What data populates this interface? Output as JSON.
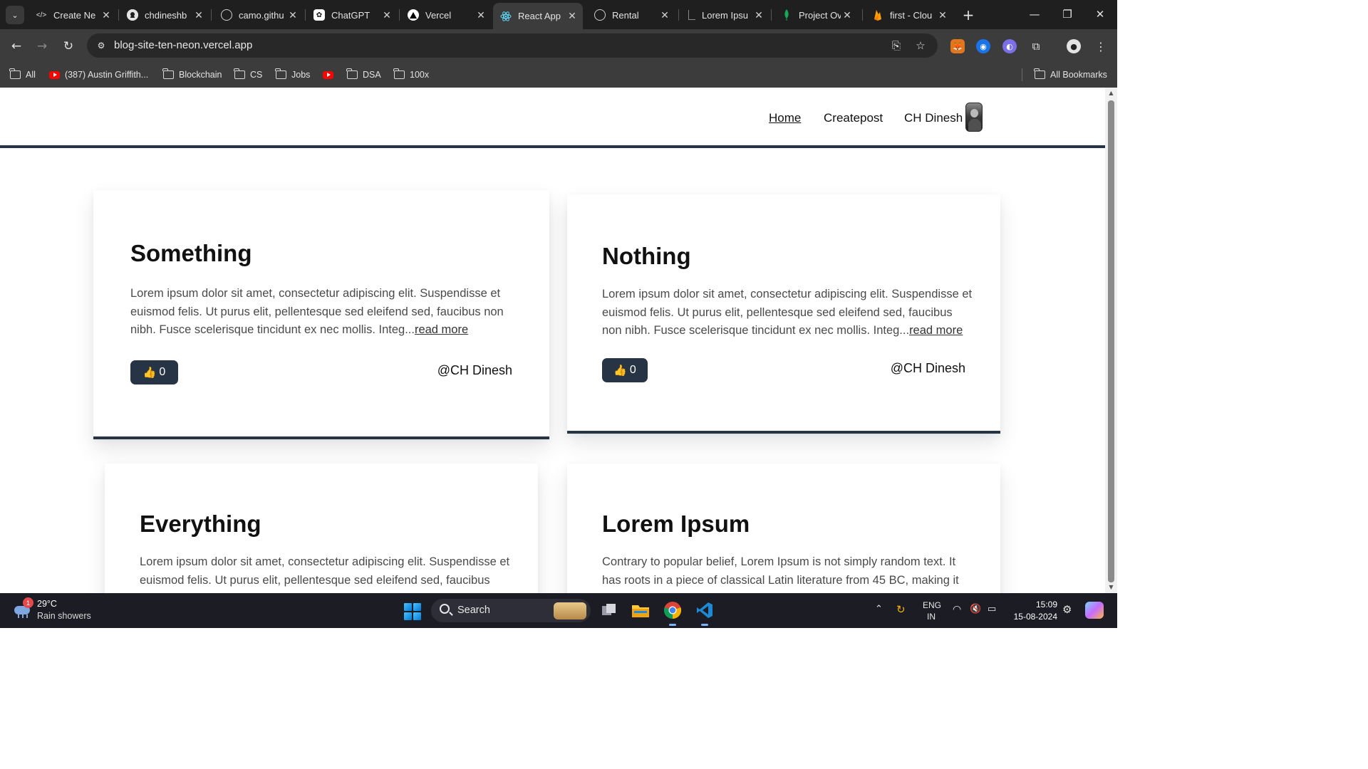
{
  "browser": {
    "tabs": [
      {
        "title": "Create Ne",
        "icon": "code-icon"
      },
      {
        "title": "chdineshb",
        "icon": "github-icon"
      },
      {
        "title": "camo.githu",
        "icon": "globe-icon"
      },
      {
        "title": "ChatGPT",
        "icon": "chatgpt-icon"
      },
      {
        "title": "Vercel",
        "icon": "vercel-icon"
      },
      {
        "title": "React App",
        "icon": "react-icon",
        "active": true
      },
      {
        "title": "Rental",
        "icon": "globe-icon"
      },
      {
        "title": "Lorem Ipsu",
        "icon": "document-icon"
      },
      {
        "title": "Project Ov",
        "icon": "mongodb-icon"
      },
      {
        "title": "first - Clou",
        "icon": "firebase-icon"
      }
    ],
    "url": "blog-site-ten-neon.vercel.app",
    "bookmarks": [
      {
        "label": "All",
        "icon": "folder-icon"
      },
      {
        "label": "(387) Austin Griffith...",
        "icon": "youtube-icon"
      },
      {
        "label": "Blockchain",
        "icon": "folder-icon"
      },
      {
        "label": "CS",
        "icon": "folder-icon"
      },
      {
        "label": "Jobs",
        "icon": "folder-icon"
      },
      {
        "label": "",
        "icon": "youtube-icon"
      },
      {
        "label": "DSA",
        "icon": "folder-icon"
      },
      {
        "label": "100x",
        "icon": "folder-icon"
      }
    ],
    "all_bookmarks": "All Bookmarks"
  },
  "site": {
    "nav": {
      "home": "Home",
      "createpost": "Createpost",
      "user": "CH Dinesh"
    },
    "posts": [
      {
        "title": "Something",
        "body": "Lorem ipsum dolor sit amet, consectetur adipiscing elit. Suspendisse et euismod felis. Ut purus elit, pellentesque sed eleifend sed, faucibus non nibh. Fusce scelerisque tincidunt ex nec mollis. Integ...",
        "read_more": "read more",
        "likes": "0",
        "author": "@CH Dinesh"
      },
      {
        "title": "Nothing",
        "body": "Lorem ipsum dolor sit amet, consectetur adipiscing elit. Suspendisse et euismod felis. Ut purus elit, pellentesque sed eleifend sed, faucibus non nibh. Fusce scelerisque tincidunt ex nec mollis. Integ...",
        "read_more": "read more",
        "likes": "0",
        "author": "@CH Dinesh"
      },
      {
        "title": "Everything",
        "body": "Lorem ipsum dolor sit amet, consectetur adipiscing elit. Suspendisse et euismod felis. Ut purus elit, pellentesque sed eleifend sed, faucibus"
      },
      {
        "title": "Lorem Ipsum",
        "body": "Contrary to popular belief, Lorem Ipsum is not simply random text. It has roots in a piece of classical Latin literature from 45 BC, making it"
      }
    ],
    "colors": {
      "accent": "#263445",
      "page_bg": "#ffffff",
      "text": "#111111",
      "muted_text": "#4a4a4a"
    }
  },
  "taskbar": {
    "weather": {
      "badge": "1",
      "temp": "29°C",
      "desc": "Rain showers"
    },
    "search_label": "Search",
    "lang": "ENG",
    "region": "IN",
    "time": "15:09",
    "date": "15-08-2024"
  }
}
